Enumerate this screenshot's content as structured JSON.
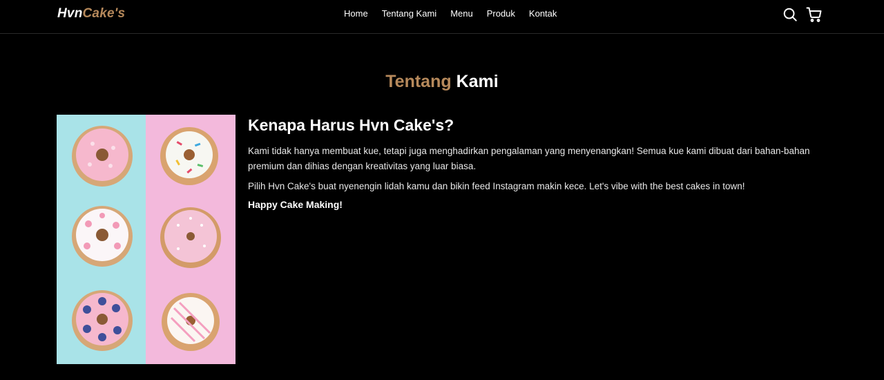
{
  "brand": {
    "part1": "Hvn",
    "part2": "Cake's"
  },
  "nav": {
    "links": [
      "Home",
      "Tentang Kami",
      "Menu",
      "Produk",
      "Kontak"
    ],
    "icons": [
      "search-icon",
      "cart-icon"
    ]
  },
  "about": {
    "title_part1": "Tentang",
    "title_part2": "Kami",
    "heading": "Kenapa Harus Hvn Cake's?",
    "paragraph1": "Kami tidak hanya membuat kue, tetapi juga menghadirkan pengalaman yang menyenangkan! Semua kue kami dibuat dari bahan-bahan premium dan dihias dengan kreativitas yang luar biasa.",
    "paragraph2": "Pilih Hvn Cake's buat nyenengin lidah kamu dan bikin feed Instagram makin kece. Let's vibe with the best cakes in town!",
    "closing": "Happy Cake Making!"
  },
  "colors": {
    "background": "#000000",
    "accent": "#b6895b",
    "text": "#ffffff",
    "panel_left": "#a9e3e8",
    "panel_right": "#f3b9dc"
  }
}
